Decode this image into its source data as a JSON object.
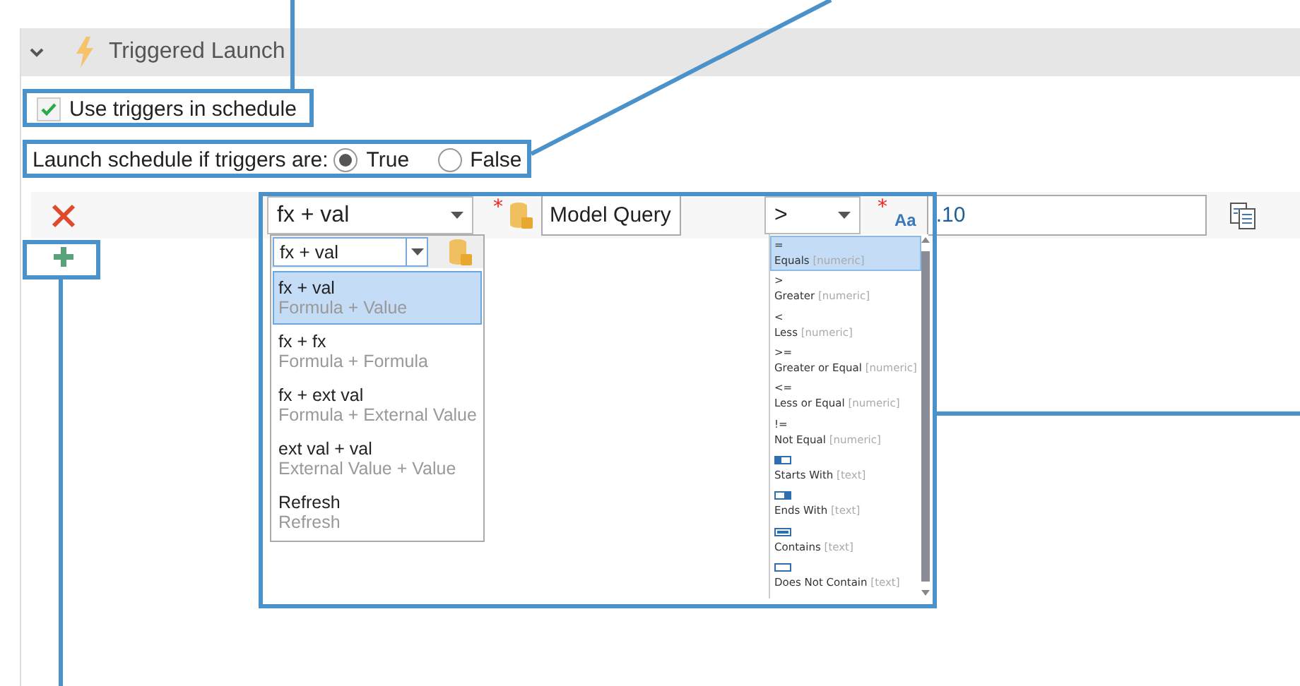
{
  "panel": {
    "title": "Triggered Launch",
    "expanded": true
  },
  "use_triggers": {
    "label": "Use triggers in schedule",
    "checked": true
  },
  "launch_if": {
    "label": "Launch schedule if triggers are:",
    "options": [
      {
        "label": "True",
        "selected": true
      },
      {
        "label": "False",
        "selected": false
      }
    ]
  },
  "condition": {
    "mode": "fx + val",
    "source_marker": "*",
    "source": "Model Query",
    "operator": ">",
    "value_marker": "*",
    "value_type": "Aa",
    "value": ".10"
  },
  "mode_dropdown": {
    "filter": "fx + val",
    "items": [
      {
        "title": "fx + val",
        "subtitle": "Formula + Value",
        "selected": true
      },
      {
        "title": "fx + fx",
        "subtitle": "Formula + Formula",
        "selected": false
      },
      {
        "title": "fx + ext val",
        "subtitle": "Formula + External Value",
        "selected": false
      },
      {
        "title": "ext val + val",
        "subtitle": "External Value + Value",
        "selected": false
      },
      {
        "title": "Refresh",
        "subtitle": "Refresh",
        "selected": false
      }
    ]
  },
  "operator_list": {
    "items": [
      {
        "kind": "symbol",
        "symbol": "=",
        "name": "Equals",
        "type": "[numeric]",
        "selected": true
      },
      {
        "kind": "symbol",
        "symbol": ">",
        "name": "Greater",
        "type": "[numeric]",
        "selected": false
      },
      {
        "kind": "symbol",
        "symbol": "<",
        "name": "Less",
        "type": "[numeric]",
        "selected": false
      },
      {
        "kind": "symbol",
        "symbol": ">=",
        "name": "Greater or Equal",
        "type": "[numeric]",
        "selected": false
      },
      {
        "kind": "symbol",
        "symbol": "<=",
        "name": "Less or Equal",
        "type": "[numeric]",
        "selected": false
      },
      {
        "kind": "symbol",
        "symbol": "!=",
        "name": "Not Equal",
        "type": "[numeric]",
        "selected": false
      },
      {
        "kind": "starts",
        "name": "Starts With",
        "type": "[text]",
        "selected": false
      },
      {
        "kind": "ends",
        "name": "Ends With",
        "type": "[text]",
        "selected": false
      },
      {
        "kind": "contains",
        "name": "Contains",
        "type": "[text]",
        "selected": false
      },
      {
        "kind": "excludes",
        "name": "Does Not Contain",
        "type": "[text]",
        "selected": false
      }
    ]
  }
}
